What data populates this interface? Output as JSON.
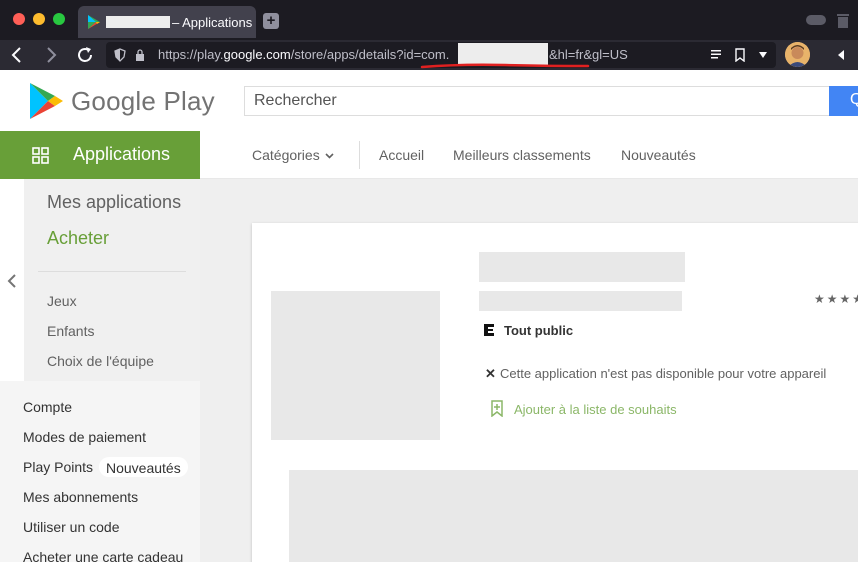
{
  "browser": {
    "tab_title": "– Applications",
    "url_prefix": "https://play.",
    "url_domain": "google.com",
    "url_path": "/store/apps/details?id=com.",
    "url_suffix": "&hl=fr&gl=US",
    "icons": [
      "close-icon",
      "minimize-icon",
      "maximize-icon",
      "back-icon",
      "forward-icon",
      "reload-icon",
      "shield-icon",
      "lock-icon",
      "reader-icon",
      "bookmark-icon",
      "chevron-down-icon",
      "avatar",
      "more-icon"
    ]
  },
  "store": {
    "logo_text": "Google Play",
    "search_placeholder": "Rechercher",
    "search_button_glyph": "Q",
    "section_label": "Applications",
    "subnav": {
      "categories": "Catégories",
      "home": "Accueil",
      "top_charts": "Meilleurs classements",
      "new_releases": "Nouveautés"
    }
  },
  "sidebar": {
    "my_apps": "Mes applications",
    "shop": "Acheter",
    "links": [
      "Jeux",
      "Enfants",
      "Choix de l'équipe"
    ],
    "account_links": [
      "Compte",
      "Modes de paiement",
      "Play Points",
      "Mes abonnements",
      "Utiliser un code",
      "Acheter une carte cadeau"
    ],
    "play_points_badge": "Nouveautés"
  },
  "app_card": {
    "stars": "★★★★",
    "content_rating": "Tout public",
    "unavailable_mark": "✕",
    "unavailable_text": "Cette application n'est pas disponible pour votre appareil",
    "wishlist_label": "Ajouter à la liste de souhaits"
  },
  "colors": {
    "accent_green": "#689f38",
    "search_blue": "#4285f4",
    "annotation_red": "#e02020"
  }
}
